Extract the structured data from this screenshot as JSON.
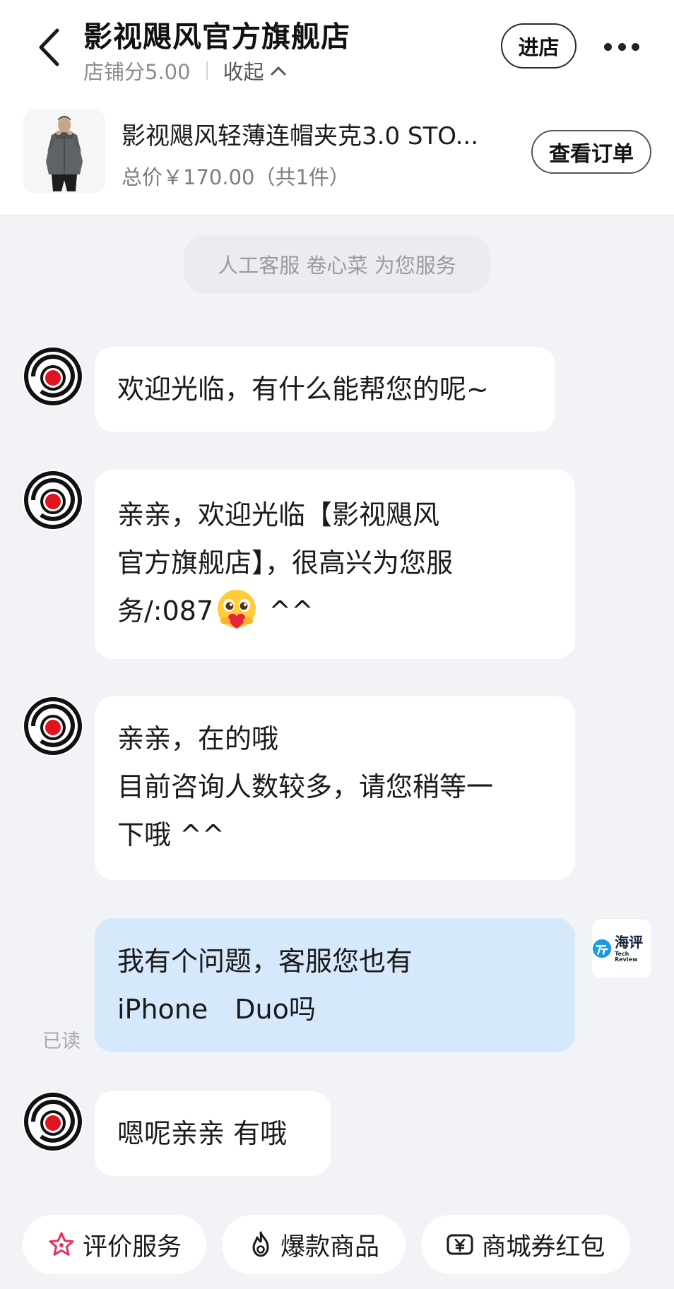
{
  "header": {
    "store_name": "影视飓风官方旗舰店",
    "store_score": "店铺分5.00",
    "collapse_label": "收起",
    "enter_store_label": "进店"
  },
  "product": {
    "name": "影视飓风轻薄连帽夹克3.0 STO...",
    "price_summary": "总价￥170.00（共1件）",
    "view_order_label": "查看订单"
  },
  "system_notice": "人工客服 卷心菜 为您服务",
  "messages": [
    {
      "sender": "shop",
      "lines": [
        "欢迎光临，有什么能帮您的呢~"
      ]
    },
    {
      "sender": "shop",
      "lines": [
        " 亲亲，欢迎光临【影视飓风",
        "官方旗舰店】，很高兴为您服",
        "务/:087"
      ],
      "tail": " ^^"
    },
    {
      "sender": "shop",
      "lines": [
        "亲亲，在的哦",
        "目前咨询人数较多，请您稍等一",
        "下哦 ^^"
      ]
    },
    {
      "sender": "user",
      "lines": [
        "我有个问题，客服您也有",
        "iPhone　Duo吗"
      ],
      "read_status": "已读"
    },
    {
      "sender": "shop",
      "lines": [
        "嗯呢亲亲 有哦"
      ]
    }
  ],
  "user_avatar": {
    "cn": "海评",
    "en": "Tech Review"
  },
  "quick_actions": [
    {
      "label": "评价服务",
      "icon": "star-icon"
    },
    {
      "label": "爆款商品",
      "icon": "flame-icon"
    },
    {
      "label": "商城券红包",
      "icon": "coupon-icon"
    }
  ],
  "colors": {
    "background": "#f1f3f7",
    "user_bubble": "#d6e9fc",
    "shop_bubble": "#ffffff",
    "logo_red": "#e0141e",
    "star_accent": "#e8325a"
  }
}
